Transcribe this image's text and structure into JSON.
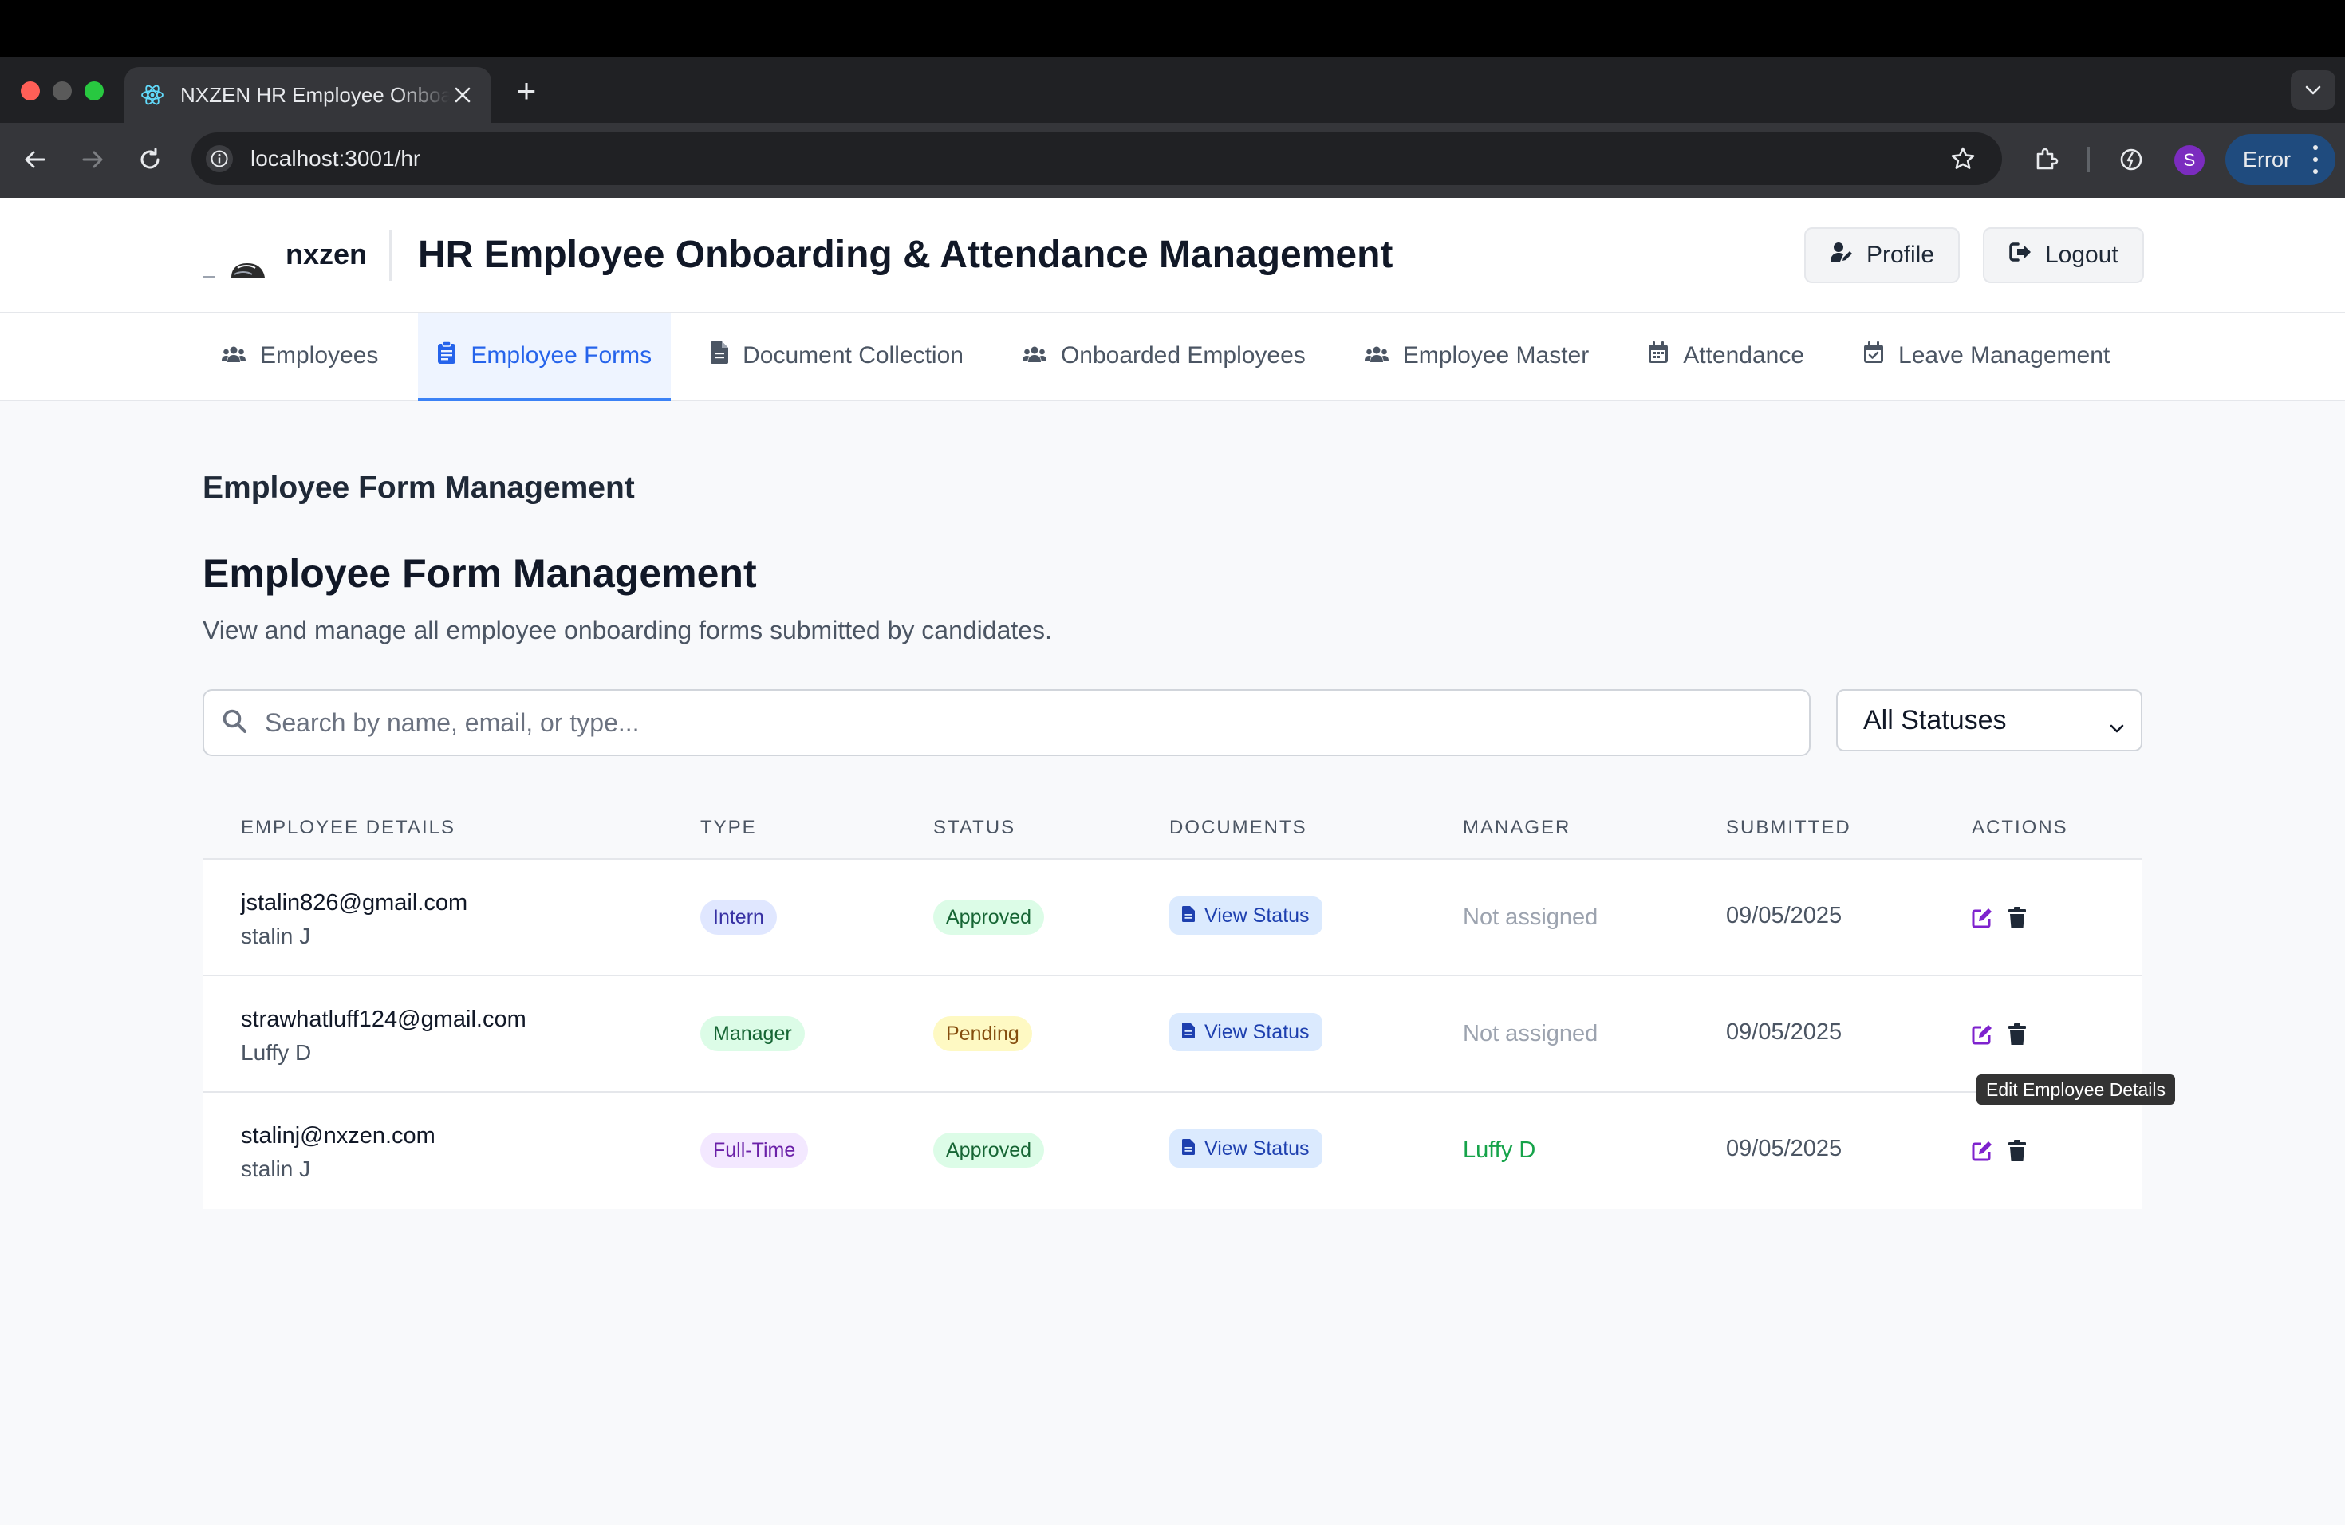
{
  "browser": {
    "tab_title": "NXZEN HR Employee Onboarding & Attendance Management",
    "new_tab": "+",
    "url": "localhost:3001/hr",
    "profile_initial": "S",
    "error_label": "Error"
  },
  "header": {
    "brand": "nxzen",
    "title": "HR Employee Onboarding & Attendance Management",
    "profile_label": "Profile",
    "logout_label": "Logout"
  },
  "nav": {
    "tabs": [
      {
        "label": "Employees",
        "icon": "users-icon"
      },
      {
        "label": "Employee Forms",
        "icon": "clipboard-icon",
        "active": true
      },
      {
        "label": "Document Collection",
        "icon": "file-icon"
      },
      {
        "label": "Onboarded Employees",
        "icon": "users-icon"
      },
      {
        "label": "Employee Master",
        "icon": "users-icon"
      },
      {
        "label": "Attendance",
        "icon": "calendar-icon"
      },
      {
        "label": "Leave Management",
        "icon": "calendar-check-icon"
      }
    ]
  },
  "main": {
    "section_heading": "Employee Form Management",
    "title": "Employee Form Management",
    "description": "View and manage all employee onboarding forms submitted by candidates.",
    "search_placeholder": "Search by name, email, or type...",
    "status_filter": "All Statuses"
  },
  "table": {
    "headers": {
      "details": "Employee Details",
      "type": "Type",
      "status": "Status",
      "documents": "Documents",
      "manager": "Manager",
      "submitted": "Submitted",
      "actions": "Actions"
    },
    "rows": [
      {
        "email": "jstalin826@gmail.com",
        "name": "stalin J",
        "type": "Intern",
        "status": "Approved",
        "documents": "View Status",
        "manager": "Not assigned",
        "submitted": "09/05/2025"
      },
      {
        "email": "strawhatluff124@gmail.com",
        "name": "Luffy D",
        "type": "Manager",
        "status": "Pending",
        "documents": "View Status",
        "manager": "Not assigned",
        "submitted": "09/05/2025"
      },
      {
        "email": "stalinj@nxzen.com",
        "name": "stalin J",
        "type": "Full-Time",
        "status": "Approved",
        "documents": "View Status",
        "manager": "Luffy D",
        "submitted": "09/05/2025"
      }
    ]
  },
  "tooltip": "Edit Employee Details",
  "colors": {
    "accent": "#2563eb",
    "approved_bg": "#dcfce7",
    "approved_fg": "#166534",
    "pending_bg": "#fef9c3",
    "pending_fg": "#854d0e",
    "assigned_manager": "#16a34a",
    "edit_icon": "#7e22ce"
  }
}
